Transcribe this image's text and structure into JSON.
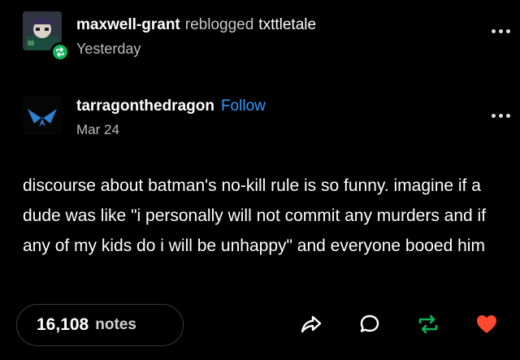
{
  "reblog": {
    "username": "maxwell-grant",
    "verb": "reblogged",
    "source": "txttletale",
    "time": "Yesterday"
  },
  "post": {
    "author": "tarragonthedragon",
    "follow_label": "Follow",
    "date": "Mar 24",
    "body": "discourse about batman's no-kill rule is so funny. imagine if a dude was like \"i personally will not commit any murders and if any of my kids do i will be unhappy\" and everyone booed him"
  },
  "footer": {
    "notes_count": "16,108",
    "notes_label": "notes"
  },
  "colors": {
    "follow": "#2e9cff",
    "reblog_green": "#11b35a",
    "like_red": "#ff4930"
  },
  "icons": [
    "reblog-icon",
    "more-icon",
    "share-icon",
    "reply-icon",
    "reblog-icon",
    "heart-icon"
  ]
}
